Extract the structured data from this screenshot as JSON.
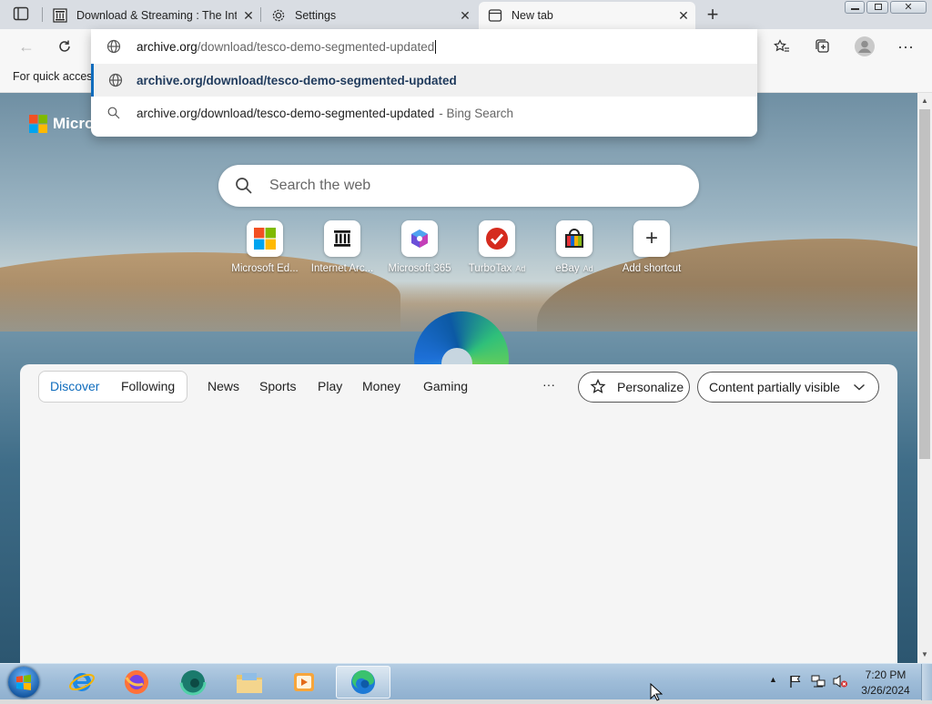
{
  "tabs": [
    {
      "title": "Download & Streaming : The Inte",
      "icon": "archive-icon"
    },
    {
      "title": "Settings",
      "icon": "gear-icon"
    },
    {
      "title": "New tab",
      "icon": "newtab-icon"
    }
  ],
  "address": {
    "host": "archive.org",
    "path": "/download/tesco-demo-segmented-updated"
  },
  "suggestions": [
    {
      "text": "archive.org/download/tesco-demo-segmented-updated",
      "suffix": ""
    },
    {
      "text": "archive.org/download/tesco-demo-segmented-updated",
      "suffix": "- Bing Search"
    }
  ],
  "favbar": {
    "text": "For quick access"
  },
  "brand": {
    "text": "Micro"
  },
  "search": {
    "placeholder": "Search the web"
  },
  "shortcuts": [
    {
      "label": "Microsoft Ed...",
      "ad": ""
    },
    {
      "label": "Internet Arc...",
      "ad": ""
    },
    {
      "label": "Microsoft 365",
      "ad": ""
    },
    {
      "label": "TurboTax",
      "ad": "Ad"
    },
    {
      "label": "eBay",
      "ad": "Ad"
    },
    {
      "label": "Add shortcut",
      "ad": ""
    }
  ],
  "feed": {
    "tabs": [
      "Discover",
      "Following"
    ],
    "nav": [
      "News",
      "Sports",
      "Play",
      "Money",
      "Gaming"
    ],
    "more": "···",
    "personalize": "Personalize",
    "content_visibility": "Content partially visible"
  },
  "clock": {
    "time": "7:20 PM",
    "date": "3/26/2024"
  },
  "colors": {
    "accent": "#0f6cbd",
    "taskbar": "#9ebcd8"
  }
}
